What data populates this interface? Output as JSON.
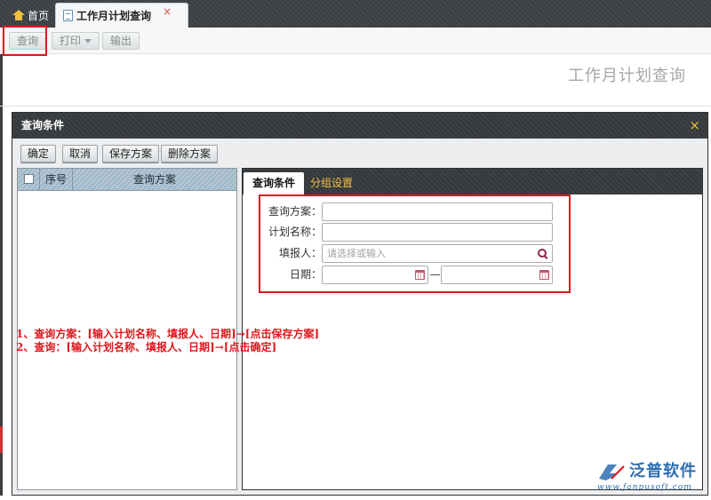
{
  "top_tabs": {
    "home_label": "首页",
    "active_label": "工作月计划查询",
    "close_glyph": "×"
  },
  "toolbar": {
    "query_label": "查询",
    "print_label": "打印",
    "export_label": "输出"
  },
  "page_title": "工作月计划查询",
  "dialog": {
    "title": "查询条件",
    "close_glyph": "×",
    "buttons": {
      "ok": "确定",
      "cancel": "取消",
      "save_scheme": "保存方案",
      "delete_scheme": "删除方案"
    },
    "scheme_list": {
      "col_seq": "序号",
      "col_scheme": "查询方案"
    },
    "right_tabs": {
      "conditions": "查询条件",
      "grouping": "分组设置"
    },
    "form": {
      "scheme_label": "查询方案：",
      "scheme_value": "",
      "plan_name_label": "计划名称：",
      "plan_name_value": "",
      "reporter_label": "填报人：",
      "reporter_placeholder": "请选择或输入",
      "date_label": "日期：",
      "date_from": "",
      "date_to": "",
      "date_sep": "—"
    }
  },
  "notes": {
    "line1": "1、查询方案：[输入计划名称、填报人、日期]→[点击保存方案]",
    "line2": "2、查询：[输入计划名称、填报人、日期]→[点击确定]"
  },
  "watermark": {
    "brand": "泛普软件",
    "url": "www.fanpusoft.com"
  },
  "colors": {
    "accent_red": "#e0161c",
    "dark_bar": "#34383b",
    "tab_yellow": "#f0c040",
    "brand_blue": "#2e6db2"
  },
  "icons": [
    "home-icon",
    "document-icon",
    "close-icon",
    "search-icon",
    "calendar-icon",
    "dropdown-caret-icon",
    "checkbox"
  ]
}
